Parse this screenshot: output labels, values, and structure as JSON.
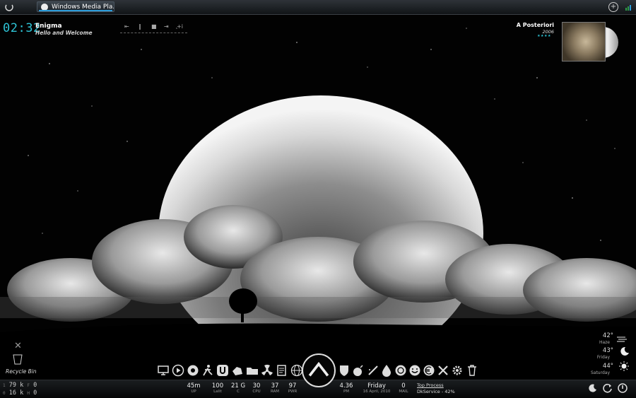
{
  "taskbar": {
    "window_title": "Windows Media Pla..."
  },
  "clock": {
    "time": "02:32"
  },
  "now_playing": {
    "title": "Enigma",
    "subtitle": "Hello and Welcome",
    "controls": [
      "⇤",
      "‖",
      "■",
      "⇥",
      "+i"
    ]
  },
  "album": {
    "title": "A Posteriori",
    "year": "2006",
    "rating": "★★★★"
  },
  "desktop": {
    "recycle_bin_label": "Recycle Bin"
  },
  "weather": [
    {
      "temp": "42°",
      "label": "Haze",
      "icon": "haze-icon"
    },
    {
      "temp": "43°",
      "label": "Friday",
      "icon": "moon-icon"
    },
    {
      "temp": "44°",
      "label": "Saturday",
      "icon": "sun-icon"
    }
  ],
  "network": {
    "up_value": "79 k",
    "down_value": "16 k",
    "f_value": "0",
    "h_value": "0",
    "up_prefix": "1",
    "down_prefix": "0",
    "f_prefix": "F",
    "h_prefix": "H"
  },
  "stats": [
    {
      "value": "45m",
      "label": "UP"
    },
    {
      "value": "100",
      "label": "Lalit"
    },
    {
      "value": "21 G",
      "label": "C"
    },
    {
      "value": "30",
      "label": "CPU"
    },
    {
      "value": "37",
      "label": "RAM"
    },
    {
      "value": "97",
      "label": "PWR"
    }
  ],
  "time_stats": [
    {
      "value": "4.36",
      "label": "PM"
    },
    {
      "value": "Friday",
      "label": "16 April, 2010"
    },
    {
      "value": "0",
      "label": "MAIL"
    }
  ],
  "top_process": {
    "heading": "Top Process",
    "value": "DkService - 42%"
  },
  "dock": {
    "icons": [
      "monitor-icon",
      "media-player-icon",
      "chrome-icon",
      "runner-icon",
      "utorrent-icon",
      "hand-icon",
      "radiation-icon",
      "notepad-icon",
      "globe-icon",
      "shield-icon",
      "bomb-icon",
      "pen-icon",
      "droplet-icon",
      "steam-icon",
      "smiley-icon",
      "euro-icon",
      "tools-icon",
      "gear-icon",
      "trash-icon"
    ]
  }
}
